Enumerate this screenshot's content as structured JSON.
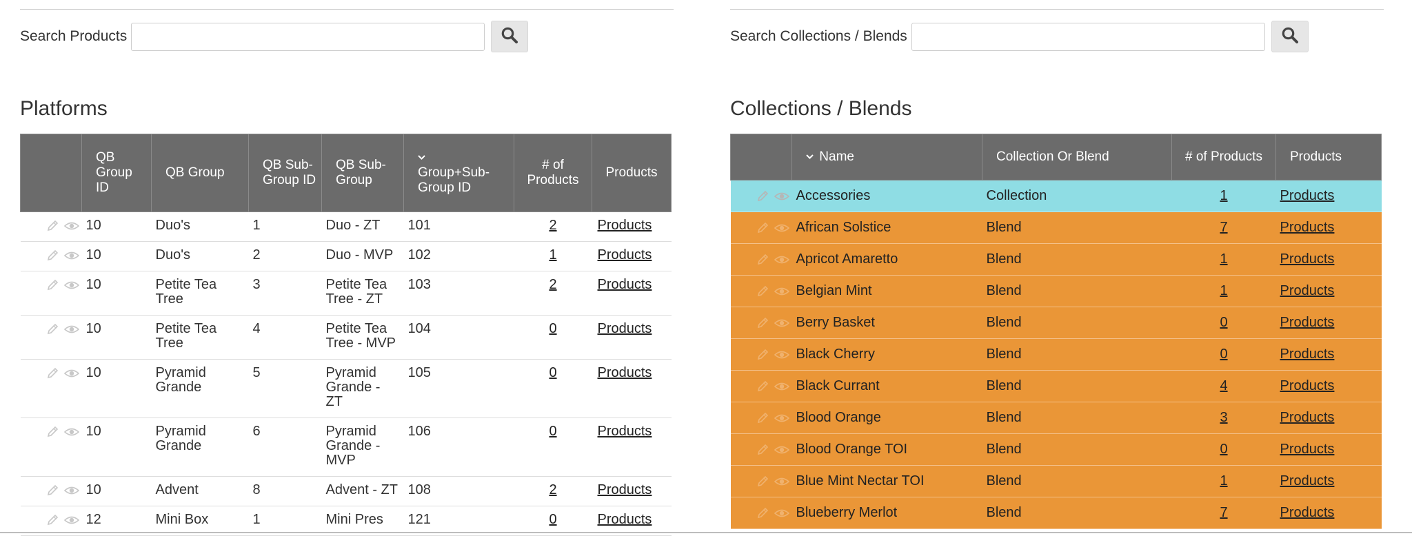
{
  "left": {
    "search": {
      "label": "Search Products",
      "value": "",
      "placeholder": ""
    },
    "title": "Platforms",
    "columns": [
      "QB Group ID",
      "QB Group",
      "QB Sub-Group ID",
      "QB Sub-Group",
      "Group+Sub-Group ID",
      "# of Products",
      "Products"
    ],
    "rows": [
      {
        "group_id": "10",
        "group": "Duo's",
        "sub_id": "1",
        "sub_group": "Duo - ZT",
        "combo_id": "101",
        "count": "2",
        "products": "Products"
      },
      {
        "group_id": "10",
        "group": "Duo's",
        "sub_id": "2",
        "sub_group": "Duo - MVP",
        "combo_id": "102",
        "count": "1",
        "products": "Products"
      },
      {
        "group_id": "10",
        "group": "Petite Tea Tree",
        "sub_id": "3",
        "sub_group": "Petite Tea Tree - ZT",
        "combo_id": "103",
        "count": "2",
        "products": "Products"
      },
      {
        "group_id": "10",
        "group": "Petite Tea Tree",
        "sub_id": "4",
        "sub_group": "Petite Tea Tree - MVP",
        "combo_id": "104",
        "count": "0",
        "products": "Products"
      },
      {
        "group_id": "10",
        "group": "Pyramid Grande",
        "sub_id": "5",
        "sub_group": "Pyramid Grande - ZT",
        "combo_id": "105",
        "count": "0",
        "products": "Products"
      },
      {
        "group_id": "10",
        "group": "Pyramid Grande",
        "sub_id": "6",
        "sub_group": "Pyramid Grande - MVP",
        "combo_id": "106",
        "count": "0",
        "products": "Products"
      },
      {
        "group_id": "10",
        "group": "Advent",
        "sub_id": "8",
        "sub_group": "Advent - ZT",
        "combo_id": "108",
        "count": "2",
        "products": "Products"
      },
      {
        "group_id": "12",
        "group": "Mini Box",
        "sub_id": "1",
        "sub_group": "Mini Pres",
        "combo_id": "121",
        "count": "0",
        "products": "Products"
      }
    ]
  },
  "right": {
    "search": {
      "label": "Search Collections / Blends",
      "value": "",
      "placeholder": ""
    },
    "title": "Collections / Blends",
    "columns": [
      "Name",
      "Collection Or Blend",
      "# of Products",
      "Products"
    ],
    "rows": [
      {
        "name": "Accessories",
        "type": "Collection",
        "count": "1",
        "products": "Products"
      },
      {
        "name": "African Solstice",
        "type": "Blend",
        "count": "7",
        "products": "Products"
      },
      {
        "name": "Apricot Amaretto",
        "type": "Blend",
        "count": "1",
        "products": "Products"
      },
      {
        "name": "Belgian Mint",
        "type": "Blend",
        "count": "1",
        "products": "Products"
      },
      {
        "name": "Berry Basket",
        "type": "Blend",
        "count": "0",
        "products": "Products"
      },
      {
        "name": "Black Cherry",
        "type": "Blend",
        "count": "0",
        "products": "Products"
      },
      {
        "name": "Black Currant",
        "type": "Blend",
        "count": "4",
        "products": "Products"
      },
      {
        "name": "Blood Orange",
        "type": "Blend",
        "count": "3",
        "products": "Products"
      },
      {
        "name": "Blood Orange TOI",
        "type": "Blend",
        "count": "0",
        "products": "Products"
      },
      {
        "name": "Blue Mint Nectar TOI",
        "type": "Blend",
        "count": "1",
        "products": "Products"
      },
      {
        "name": "Blueberry Merlot",
        "type": "Blend",
        "count": "7",
        "products": "Products"
      }
    ]
  },
  "icons": {
    "search": "search-icon",
    "edit": "pencil-icon",
    "view": "eye-icon",
    "sort": "sort-down-icon"
  },
  "colors": {
    "header": "#6b6b6b",
    "blend_row": "#ea9637",
    "collection_row": "#8fdde4"
  }
}
